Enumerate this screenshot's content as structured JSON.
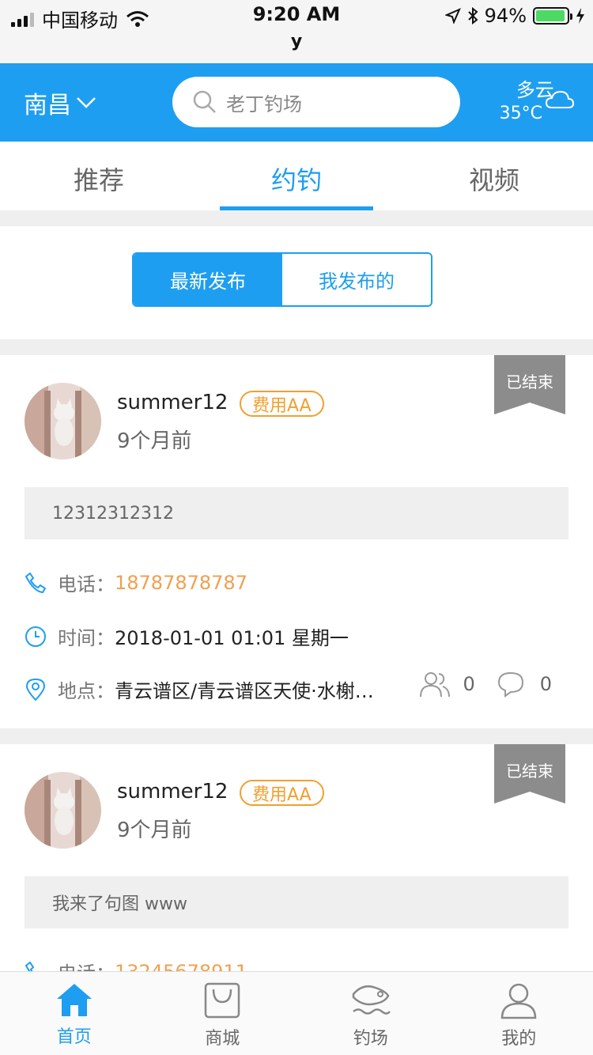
{
  "status_bar": {
    "carrier": "中国移动",
    "time": "9:20 AM",
    "subtitle": "y",
    "battery": "94%",
    "battery_level": 0.94
  },
  "header": {
    "city": "南昌",
    "search_placeholder": "老丁钓场",
    "weather_desc": "多云",
    "weather_temp": "35°C"
  },
  "tabs": [
    {
      "label": "推荐",
      "active": false
    },
    {
      "label": "约钓",
      "active": true
    },
    {
      "label": "视频",
      "active": false
    }
  ],
  "segment": {
    "latest": "最新发布",
    "mine": "我发布的"
  },
  "colors": {
    "primary": "#1e9ef0",
    "badge": "#f0a030",
    "phone": "#f0a050",
    "ribbon": "#8c8c8c"
  },
  "posts": [
    {
      "username": "summer12",
      "fee": "费用AA",
      "time_ago": "9个月前",
      "status": "已结束",
      "content": "12312312312",
      "phone_label": "电话：",
      "phone": "18787878787",
      "time_label": "时间：",
      "datetime": "2018-01-01 01:01 星期一",
      "location_label": "地点：",
      "location": "青云谱区/青云谱区天使·水榭…",
      "participants": "0",
      "comments": "0"
    },
    {
      "username": "summer12",
      "fee": "费用AA",
      "time_ago": "9个月前",
      "status": "已结束",
      "content": "我来了句图 www",
      "phone_label": "电话：",
      "phone": "13245678911"
    }
  ],
  "tabbar": [
    {
      "label": "首页",
      "icon": "home-icon",
      "active": true
    },
    {
      "label": "商城",
      "icon": "shopping-bag-icon",
      "active": false
    },
    {
      "label": "钓场",
      "icon": "fish-icon",
      "active": false
    },
    {
      "label": "我的",
      "icon": "profile-icon",
      "active": false
    }
  ]
}
